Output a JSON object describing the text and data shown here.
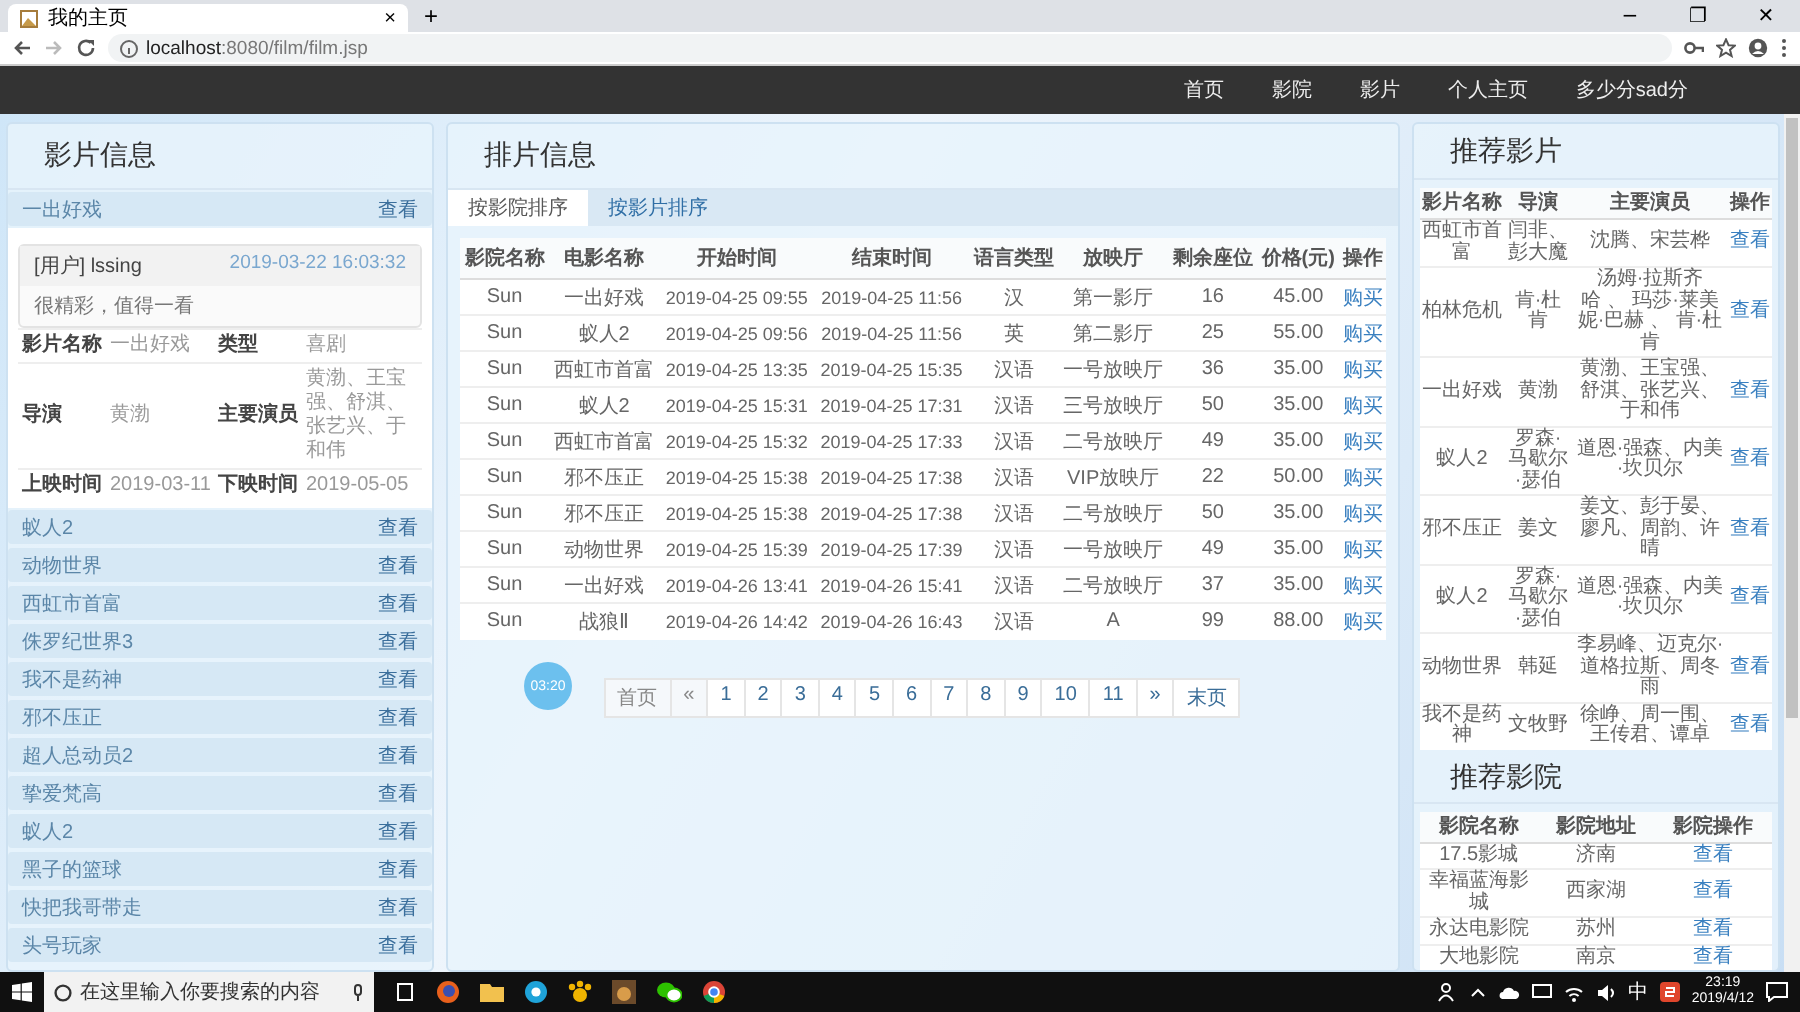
{
  "browser": {
    "tab_title": "我的主页",
    "tab_close": "×",
    "new_tab": "+",
    "address_host": "localhost",
    "address_path": ":8080/film/film.jsp",
    "window_buttons": [
      "−",
      "❐",
      "✕"
    ]
  },
  "navbar": {
    "items": [
      {
        "label": "首页"
      },
      {
        "label": "影院"
      },
      {
        "label": "影片"
      },
      {
        "label": "个人主页"
      },
      {
        "label": "多少分sad分"
      }
    ]
  },
  "film_info": {
    "title": "影片信息",
    "expanded": {
      "name": "一出好戏",
      "action": "查看",
      "comment": {
        "user": "[用户] lssing",
        "time": "2019-03-22 16:03:32",
        "text": "很精彩，值得一看"
      },
      "details": [
        [
          "影片名称",
          "一出好戏",
          "类型",
          "喜剧"
        ],
        [
          "导演",
          "黄渤",
          "主要演员",
          "黄渤、王宝强、舒淇、张艺兴、于和伟"
        ],
        [
          "上映时间",
          "2019-03-11",
          "下映时间",
          "2019-05-05"
        ]
      ]
    },
    "films": [
      {
        "name": "蚁人2",
        "action": "查看"
      },
      {
        "name": "动物世界",
        "action": "查看"
      },
      {
        "name": "西虹市首富",
        "action": "查看"
      },
      {
        "name": "侏罗纪世界3",
        "action": "查看"
      },
      {
        "name": "我不是药神",
        "action": "查看"
      },
      {
        "name": "邪不压正",
        "action": "查看"
      },
      {
        "name": "超人总动员2",
        "action": "查看"
      },
      {
        "name": "挚爱梵高",
        "action": "查看"
      },
      {
        "name": "蚁人2",
        "action": "查看"
      },
      {
        "name": "黑子的篮球",
        "action": "查看"
      },
      {
        "name": "快把我哥带走",
        "action": "查看"
      },
      {
        "name": "头号玩家",
        "action": "查看"
      }
    ]
  },
  "schedule": {
    "title": "排片信息",
    "tabs": [
      {
        "label": "按影院排序",
        "selected": true
      },
      {
        "label": "按影片排序",
        "selected": false
      }
    ],
    "columns": [
      "影院名称",
      "电影名称",
      "开始时间",
      "结束时间",
      "语言类型",
      "放映厅",
      "剩余座位",
      "价格(元)",
      "操作"
    ],
    "rows": [
      [
        "Sun",
        "一出好戏",
        "2019-04-25 09:55",
        "2019-04-25 11:56",
        "汉",
        "第一影厅",
        "16",
        "45.00",
        "购买"
      ],
      [
        "Sun",
        "蚁人2",
        "2019-04-25 09:56",
        "2019-04-25 11:56",
        "英",
        "第二影厅",
        "25",
        "55.00",
        "购买"
      ],
      [
        "Sun",
        "西虹市首富",
        "2019-04-25 13:35",
        "2019-04-25 15:35",
        "汉语",
        "一号放映厅",
        "36",
        "35.00",
        "购买"
      ],
      [
        "Sun",
        "蚁人2",
        "2019-04-25 15:31",
        "2019-04-25 17:31",
        "汉语",
        "三号放映厅",
        "50",
        "35.00",
        "购买"
      ],
      [
        "Sun",
        "西虹市首富",
        "2019-04-25 15:32",
        "2019-04-25 17:33",
        "汉语",
        "二号放映厅",
        "49",
        "35.00",
        "购买"
      ],
      [
        "Sun",
        "邪不压正",
        "2019-04-25 15:38",
        "2019-04-25 17:38",
        "汉语",
        "VIP放映厅",
        "22",
        "50.00",
        "购买"
      ],
      [
        "Sun",
        "邪不压正",
        "2019-04-25 15:38",
        "2019-04-25 17:38",
        "汉语",
        "二号放映厅",
        "50",
        "35.00",
        "购买"
      ],
      [
        "Sun",
        "动物世界",
        "2019-04-25 15:39",
        "2019-04-25 17:39",
        "汉语",
        "一号放映厅",
        "49",
        "35.00",
        "购买"
      ],
      [
        "Sun",
        "一出好戏",
        "2019-04-26 13:41",
        "2019-04-26 15:41",
        "汉语",
        "二号放映厅",
        "37",
        "35.00",
        "购买"
      ],
      [
        "Sun",
        "战狼Ⅱ",
        "2019-04-26 14:42",
        "2019-04-26 16:43",
        "汉语",
        "A",
        "99",
        "88.00",
        "购买"
      ]
    ],
    "pagination": [
      {
        "label": "首页",
        "disabled": true
      },
      {
        "label": "«",
        "disabled": true
      },
      {
        "label": "1",
        "disabled": false
      },
      {
        "label": "2",
        "disabled": false
      },
      {
        "label": "3",
        "disabled": false
      },
      {
        "label": "4",
        "disabled": false
      },
      {
        "label": "5",
        "disabled": false
      },
      {
        "label": "6",
        "disabled": false
      },
      {
        "label": "7",
        "disabled": false
      },
      {
        "label": "8",
        "disabled": false
      },
      {
        "label": "9",
        "disabled": false
      },
      {
        "label": "10",
        "disabled": false
      },
      {
        "label": "11",
        "disabled": false
      },
      {
        "label": "»",
        "disabled": false
      },
      {
        "label": "末页",
        "disabled": false
      }
    ],
    "overlay_badge": "03:20"
  },
  "recommended_films": {
    "title": "推荐影片",
    "columns": [
      "影片名称",
      "导演",
      "主要演员",
      "操作"
    ],
    "rows": [
      [
        "西虹市首富",
        "闫非、彭大魔",
        "沈腾、宋芸桦",
        "查看"
      ],
      [
        "柏林危机",
        "肯·杜肯",
        "汤姆·拉斯齐哈 、 玛莎·莱美妮·巴赫 、 肯·杜肯",
        "查看"
      ],
      [
        "一出好戏",
        "黄渤",
        "黄渤、王宝强、舒淇、张艺兴、于和伟",
        "查看"
      ],
      [
        "蚁人2",
        "罗森·马歇尔·瑟伯",
        "道恩·强森、内美·坎贝尔",
        "查看"
      ],
      [
        "邪不压正",
        "姜文",
        "姜文、彭于晏、廖凡、周韵、许晴",
        "查看"
      ],
      [
        "蚁人2",
        "罗森·马歇尔·瑟伯",
        "道恩·强森、内美·坎贝尔",
        "查看"
      ],
      [
        "动物世界",
        "韩延",
        "李易峰、迈克尔·道格拉斯、周冬雨",
        "查看"
      ],
      [
        "我不是药神",
        "文牧野",
        "徐峥、周一围、王传君、谭卓",
        "查看"
      ]
    ]
  },
  "recommended_cinemas": {
    "title": "推荐影院",
    "columns": [
      "影院名称",
      "影院地址",
      "影院操作"
    ],
    "rows": [
      [
        "17.5影城",
        "济南",
        "查看"
      ],
      [
        "幸福蓝海影城",
        "西家湖",
        "查看"
      ],
      [
        "永达电影院",
        "苏州",
        "查看"
      ],
      [
        "大地影院",
        "南京",
        "查看"
      ]
    ]
  },
  "taskbar": {
    "search_placeholder": "在这里输入你要搜索的内容",
    "ime": "中",
    "time": "23:19",
    "date": "2019/4/12"
  }
}
